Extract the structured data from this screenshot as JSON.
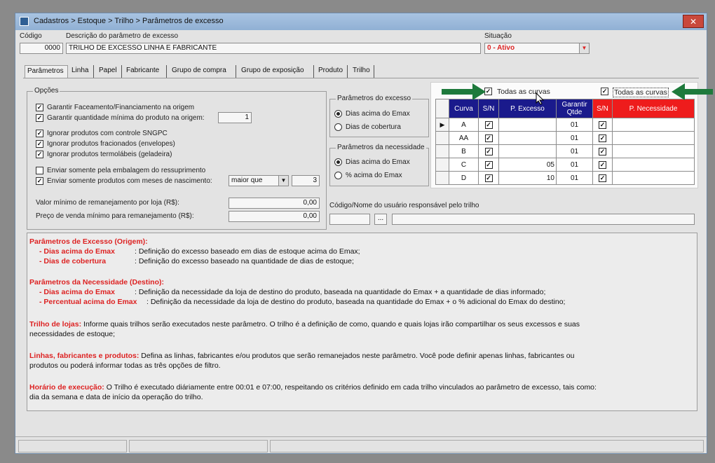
{
  "window": {
    "title": "Cadastros > Estoque > Trilho > Parâmetros de excesso",
    "close": "✕"
  },
  "header": {
    "codigo_label": "Código",
    "codigo_value": "0000",
    "descricao_label": "Descrição do parâmetro de excesso",
    "descricao_value": "TRILHO DE EXCESSO LINHA E FABRICANTE",
    "situacao_label": "Situação",
    "situacao_value": "0 - Ativo"
  },
  "tabs": [
    "Parâmetros",
    "Linha",
    "Papel",
    "Fabricante",
    "Grupo de compra",
    "Grupo de exposição",
    "Produto",
    "Trilho"
  ],
  "opcoes": {
    "title": "Opções",
    "items": [
      "Garantir Faceamento/Financiamento na origem",
      "Garantir quantidade mínima do produto na origem:",
      "Ignorar produtos com controle SNGPC",
      "Ignorar produtos fracionados (envelopes)",
      "Ignorar produtos termolábeis (geladeira)",
      "Enviar somente pela embalagem do ressuprimento",
      "Enviar somente produtos com meses de nascimento:"
    ],
    "qtd_minima": "1",
    "meses_operador": "maior que",
    "meses_valor": "3",
    "valor_minimo_label": "Valor mínimo de remanejamento por loja (R$):",
    "valor_minimo": "0,00",
    "preco_minimo_label": "Preço de venda mínimo para remanejamento (R$):",
    "preco_minimo": "0,00"
  },
  "param_excesso": {
    "title": "Parâmetros do excesso",
    "opt1": "Dias acima do Emax",
    "opt2": "Dias de cobertura"
  },
  "param_necessidade": {
    "title": "Parâmetros da necessidade",
    "opt1": "Dias acima do Emax",
    "opt2": "% acima do Emax"
  },
  "usuario": {
    "label": "Código/Nome do usuário responsável pelo trilho",
    "lookup": "..."
  },
  "grid_popup": {
    "todas_left": "Todas as curvas",
    "todas_right": "Todas as curvas",
    "headers": {
      "curva": "Curva",
      "sn": "S/N",
      "p_excesso": "P. Excesso",
      "garantir": "Garantir Qtde",
      "sn2": "S/N",
      "p_necessidade": "P. Necessidade"
    },
    "rows": [
      {
        "curva": "A",
        "excesso": "",
        "garantir": "01"
      },
      {
        "curva": "AA",
        "excesso": "",
        "garantir": "01"
      },
      {
        "curva": "B",
        "excesso": "",
        "garantir": "01"
      },
      {
        "curva": "C",
        "excesso": "05",
        "garantir": "01"
      },
      {
        "curva": "D",
        "excesso": "10",
        "garantir": "01"
      }
    ]
  },
  "info": {
    "h1": "Parâmetros de Excesso (Origem):",
    "h1a_k": "- Dias acima do Emax",
    "h1a_v": ": Definição do excesso baseado em dias de estoque acima do Emax;",
    "h1b_k": "- Dias de cobertura",
    "h1b_v": ": Definição do excesso baseado na quantidade de dias de estoque;",
    "h2": "Parâmetros da Necessidade (Destino):",
    "h2a_k": "- Dias acima do Emax",
    "h2a_v": ": Definição da necessidade da loja de destino do produto, baseada na quantidade do Emax + a quantidade de dias informado;",
    "h2b_k": "- Percentual acima do Emax",
    "h2b_v": ": Definição da necessidade da loja de destino do produto, baseada na quantidade do Emax + o % adicional do Emax do destino;",
    "t3_k": "Trilho de lojas:",
    "t3_v1": " Informe quais trilhos serão executados neste parâmetro. O trilho é a definição de como, quando e quais lojas irão compartilhar os seus excessos e suas",
    "t3_v2": "necessidades de estoque;",
    "t4_k": "Linhas, fabricantes e produtos:",
    "t4_v1": " Defina as linhas, fabricantes e/ou produtos que serão remanejados neste parâmetro. Você pode definir apenas linhas, fabricantes ou",
    "t4_v2": "produtos ou poderá informar todas as três opções de filtro.",
    "t5_k": "Horário de execução:",
    "t5_v1": " O Trilho é executado diáriamente entre 00:01 e 07:00, respeitando os critérios definido em cada trilho vinculados ao parâmetro de excesso, tais como:",
    "t5_v2": "dia da semana e data de início da operação do trilho."
  },
  "colors": {
    "header_blue": "#1a1a8c",
    "header_red": "#ee1c1c",
    "arrow_green": "#1e7a3c",
    "info_red": "#dd2222"
  },
  "icons": [
    "app-icon",
    "close-icon",
    "checkbox-icon",
    "radio-icon",
    "dropdown-arrow-icon",
    "green-arrow-icon",
    "row-pointer-icon",
    "mouse-cursor-icon"
  ]
}
